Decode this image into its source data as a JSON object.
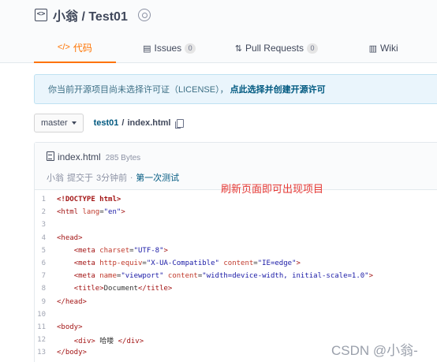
{
  "repo": {
    "owner": "小翁",
    "separator": "/",
    "name": "Test01",
    "title": "小翁 / Test01"
  },
  "tabs": [
    {
      "icon": "</>",
      "label": "代码",
      "count": null,
      "active": true
    },
    {
      "icon": "▤",
      "label": "Issues",
      "count": "0",
      "active": false
    },
    {
      "icon": "⇅",
      "label": "Pull Requests",
      "count": "0",
      "active": false
    },
    {
      "icon": "▥",
      "label": "Wiki",
      "count": null,
      "active": false
    }
  ],
  "license_notice": {
    "text": "你当前开源项目尚未选择许可证（LICENSE），",
    "link": "点此选择并创建开源许可"
  },
  "branch": {
    "name": "master"
  },
  "breadcrumb": {
    "repo": "test01",
    "sep": "/",
    "file": "index.html"
  },
  "file": {
    "name": "index.html",
    "size": "285 Bytes"
  },
  "commit": {
    "author": "小翁",
    "action": "提交于",
    "time": "3分钟前",
    "dot": ".",
    "message": "第一次测试"
  },
  "annotation": "刷新页面即可出现项目",
  "code_lines": [
    {
      "n": "1",
      "html": "<span class='doctype'>&lt;!DOCTYPE html&gt;</span>"
    },
    {
      "n": "2",
      "html": "<span class='tag'>&lt;html</span> <span class='attr'>lang</span>=<span class='val'>\"en\"</span><span class='tag'>&gt;</span>"
    },
    {
      "n": "3",
      "html": ""
    },
    {
      "n": "4",
      "html": "<span class='tag'>&lt;head&gt;</span>"
    },
    {
      "n": "5",
      "html": "    <span class='tag'>&lt;meta</span> <span class='attr'>charset</span>=<span class='val'>\"UTF-8\"</span><span class='tag'>&gt;</span>"
    },
    {
      "n": "6",
      "html": "    <span class='tag'>&lt;meta</span> <span class='attr'>http-equiv</span>=<span class='val'>\"X-UA-Compatible\"</span> <span class='attr'>content</span>=<span class='val'>\"IE=edge\"</span><span class='tag'>&gt;</span>"
    },
    {
      "n": "7",
      "html": "    <span class='tag'>&lt;meta</span> <span class='attr'>name</span>=<span class='val'>\"viewport\"</span> <span class='attr'>content</span>=<span class='val'>\"width=device-width, initial-scale=1.0\"</span><span class='tag'>&gt;</span>"
    },
    {
      "n": "8",
      "html": "    <span class='tag'>&lt;title&gt;</span>Document<span class='tag'>&lt;/title&gt;</span>"
    },
    {
      "n": "9",
      "html": "<span class='tag'>&lt;/head&gt;</span>"
    },
    {
      "n": "10",
      "html": ""
    },
    {
      "n": "11",
      "html": "<span class='tag'>&lt;body&gt;</span>"
    },
    {
      "n": "12",
      "html": "    <span class='tag'>&lt;div&gt;</span> 哈喽 <span class='tag'>&lt;/div&gt;</span>"
    },
    {
      "n": "13",
      "html": "<span class='tag'>&lt;/body&gt;</span>"
    }
  ],
  "watermark": "CSDN @小翁-",
  "colors": {
    "accent": "#fe7300",
    "link": "#005980",
    "annotation": "#e53935"
  }
}
